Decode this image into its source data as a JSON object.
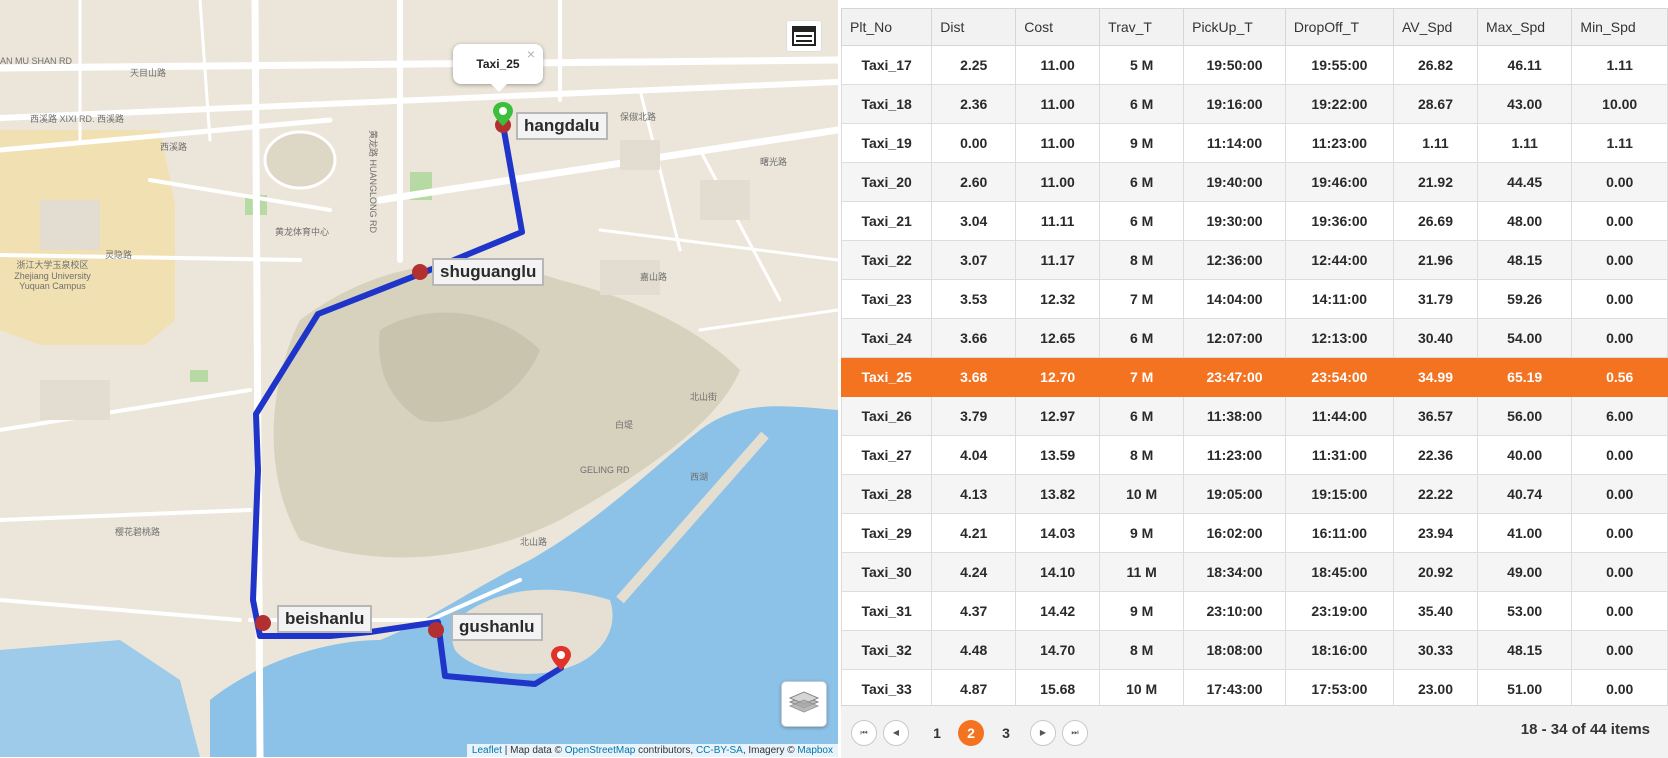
{
  "map": {
    "popup": {
      "title": "Taxi_25",
      "close": "×"
    },
    "stops": {
      "start": "hangdalu",
      "s2": "shuguanglu",
      "s3": "beishanlu",
      "s4": "gushanlu"
    },
    "street_labels": [
      "AN MU SHAN RD",
      "天目山路",
      "西溪路 XIXI RD. 西溪路",
      "西溪路",
      "黄龙路 HUANGLONG RD",
      "保俶北路",
      "曙光路",
      "灵隐路",
      "北山街",
      "白堤",
      "西湖",
      "北山路",
      "GELING RD",
      "嘉山路",
      "浙江大学玉泉校区 Zhejiang University Yuquan Campus",
      "黄龙体育中心",
      "樱花碧桃路"
    ],
    "attribution": {
      "a": "Leaflet",
      "b": " | Map data © ",
      "c": "OpenStreetMap",
      "d": " contributors, ",
      "e": "CC-BY-SA",
      "f": ", Imagery © ",
      "g": "Mapbox"
    }
  },
  "grid": {
    "columns": [
      "Plt_No",
      "Dist",
      "Cost",
      "Trav_T",
      "PickUp_T",
      "DropOff_T",
      "AV_Spd",
      "Max_Spd",
      "Min_Spd"
    ],
    "rows": [
      [
        "Taxi_17",
        "2.25",
        "11.00",
        "5 M",
        "19:50:00",
        "19:55:00",
        "26.82",
        "46.11",
        "1.11"
      ],
      [
        "Taxi_18",
        "2.36",
        "11.00",
        "6 M",
        "19:16:00",
        "19:22:00",
        "28.67",
        "43.00",
        "10.00"
      ],
      [
        "Taxi_19",
        "0.00",
        "11.00",
        "9 M",
        "11:14:00",
        "11:23:00",
        "1.11",
        "1.11",
        "1.11"
      ],
      [
        "Taxi_20",
        "2.60",
        "11.00",
        "6 M",
        "19:40:00",
        "19:46:00",
        "21.92",
        "44.45",
        "0.00"
      ],
      [
        "Taxi_21",
        "3.04",
        "11.11",
        "6 M",
        "19:30:00",
        "19:36:00",
        "26.69",
        "48.00",
        "0.00"
      ],
      [
        "Taxi_22",
        "3.07",
        "11.17",
        "8 M",
        "12:36:00",
        "12:44:00",
        "21.96",
        "48.15",
        "0.00"
      ],
      [
        "Taxi_23",
        "3.53",
        "12.32",
        "7 M",
        "14:04:00",
        "14:11:00",
        "31.79",
        "59.26",
        "0.00"
      ],
      [
        "Taxi_24",
        "3.66",
        "12.65",
        "6 M",
        "12:07:00",
        "12:13:00",
        "30.40",
        "54.00",
        "0.00"
      ],
      [
        "Taxi_25",
        "3.68",
        "12.70",
        "7 M",
        "23:47:00",
        "23:54:00",
        "34.99",
        "65.19",
        "0.56"
      ],
      [
        "Taxi_26",
        "3.79",
        "12.97",
        "6 M",
        "11:38:00",
        "11:44:00",
        "36.57",
        "56.00",
        "6.00"
      ],
      [
        "Taxi_27",
        "4.04",
        "13.59",
        "8 M",
        "11:23:00",
        "11:31:00",
        "22.36",
        "40.00",
        "0.00"
      ],
      [
        "Taxi_28",
        "4.13",
        "13.82",
        "10 M",
        "19:05:00",
        "19:15:00",
        "22.22",
        "40.74",
        "0.00"
      ],
      [
        "Taxi_29",
        "4.21",
        "14.03",
        "9 M",
        "16:02:00",
        "16:11:00",
        "23.94",
        "41.00",
        "0.00"
      ],
      [
        "Taxi_30",
        "4.24",
        "14.10",
        "11 M",
        "18:34:00",
        "18:45:00",
        "20.92",
        "49.00",
        "0.00"
      ],
      [
        "Taxi_31",
        "4.37",
        "14.42",
        "9 M",
        "23:10:00",
        "23:19:00",
        "35.40",
        "53.00",
        "0.00"
      ],
      [
        "Taxi_32",
        "4.48",
        "14.70",
        "8 M",
        "18:08:00",
        "18:16:00",
        "30.33",
        "48.15",
        "0.00"
      ],
      [
        "Taxi_33",
        "4.87",
        "15.68",
        "10 M",
        "17:43:00",
        "17:53:00",
        "23.00",
        "51.00",
        "0.00"
      ]
    ],
    "selected_row": 8,
    "pager": {
      "first": "⏮",
      "prev": "◀",
      "next": "▶",
      "last": "⏭",
      "pages": [
        "1",
        "2",
        "3"
      ],
      "current_page": 2,
      "info": "18 - 34 of 44 items"
    }
  },
  "colors": {
    "accent": "#f37321",
    "route": "#1f35c9",
    "water": "#8cc2e8"
  }
}
